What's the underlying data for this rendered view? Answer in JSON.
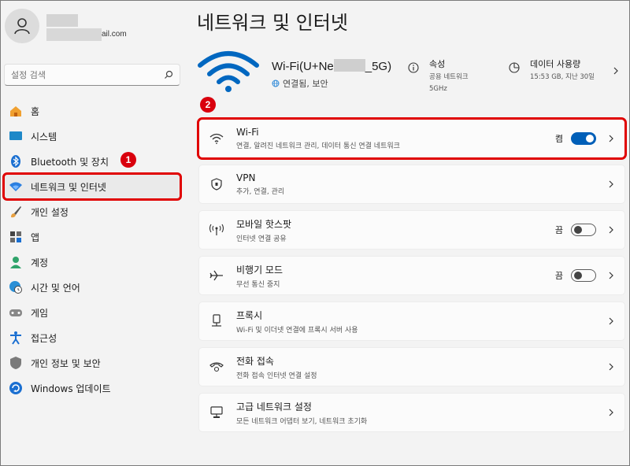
{
  "account": {
    "email_suffix": "ail.com"
  },
  "search": {
    "placeholder": "설정 검색"
  },
  "nav": [
    {
      "label": "홈",
      "icon": "home-icon"
    },
    {
      "label": "시스템",
      "icon": "system-icon"
    },
    {
      "label": "Bluetooth 및 장치",
      "icon": "bluetooth-icon"
    },
    {
      "label": "네트워크 및 인터넷",
      "icon": "network-icon",
      "active": true
    },
    {
      "label": "개인 설정",
      "icon": "brush-icon"
    },
    {
      "label": "앱",
      "icon": "apps-icon"
    },
    {
      "label": "계정",
      "icon": "person-icon"
    },
    {
      "label": "시간 및 언어",
      "icon": "globe-clock-icon"
    },
    {
      "label": "게임",
      "icon": "gamepad-icon"
    },
    {
      "label": "접근성",
      "icon": "accessibility-icon"
    },
    {
      "label": "개인 정보 및 보안",
      "icon": "shield-icon"
    },
    {
      "label": "Windows 업데이트",
      "icon": "update-icon"
    }
  ],
  "badges": {
    "one": "1",
    "two": "2"
  },
  "page": {
    "title": "네트워크 및 인터넷",
    "ssid_prefix": "Wi-Fi(U+Ne",
    "ssid_suffix": "_5G)",
    "connection": "연결됨, 보안",
    "props": {
      "property_title": "속성",
      "property_value1": "공용 네트워크",
      "property_value2": "5GHz",
      "data_title": "데이터 사용량",
      "data_value": "15:53 GB, 지난 30일"
    }
  },
  "cards": [
    {
      "title": "Wi-Fi",
      "subtitle": "연결, 알려진 네트워크 관리, 데이터 통신 연결 네트워크",
      "state": "켬",
      "toggle": "on",
      "icon": "wifi-icon"
    },
    {
      "title": "VPN",
      "subtitle": "추가, 연결, 관리",
      "icon": "vpn-shield-icon"
    },
    {
      "title": "모바일 핫스팟",
      "subtitle": "인터넷 연결 공유",
      "state": "끔",
      "toggle": "off",
      "icon": "hotspot-icon"
    },
    {
      "title": "비행기 모드",
      "subtitle": "무선 통신 중지",
      "state": "끔",
      "toggle": "off",
      "icon": "airplane-icon"
    },
    {
      "title": "프록시",
      "subtitle": "Wi-Fi 및 이더넷 연결에 프록시 서버 사용",
      "icon": "proxy-icon"
    },
    {
      "title": "전화 접속",
      "subtitle": "전화 접속 인터넷 연결 설정",
      "icon": "dialup-icon"
    },
    {
      "title": "고급 네트워크 설정",
      "subtitle": "모든 네트워크 어댑터 보기, 네트워크 초기화",
      "icon": "advanced-network-icon"
    }
  ],
  "colors": {
    "accent": "#005fb8",
    "highlight": "#e00000"
  }
}
